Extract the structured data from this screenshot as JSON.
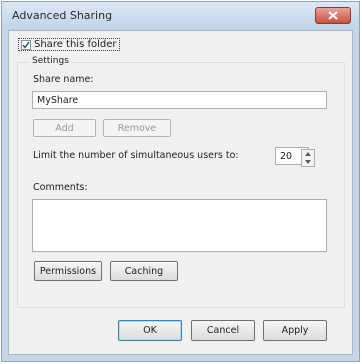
{
  "window": {
    "title": "Advanced Sharing"
  },
  "share_checkbox": {
    "label": "Share this folder",
    "checked": true
  },
  "settings": {
    "legend": "Settings",
    "share_name_label": "Share name:",
    "share_name_value": "MyShare",
    "add_label": "Add",
    "remove_label": "Remove",
    "limit_label": "Limit the number of simultaneous users to:",
    "limit_value": "20",
    "comments_label": "Comments:",
    "comments_value": "",
    "permissions_label": "Permissions",
    "caching_label": "Caching"
  },
  "footer": {
    "ok_label": "OK",
    "cancel_label": "Cancel",
    "apply_label": "Apply"
  },
  "colors": {
    "title_bar": "#c6d6e8",
    "close_button": "#c9503f",
    "dialog_bg": "#f0f0f0"
  },
  "icons": {
    "close": "close-icon",
    "check": "checkmark-icon",
    "spin_up": "spin-up-icon",
    "spin_down": "spin-down-icon"
  }
}
